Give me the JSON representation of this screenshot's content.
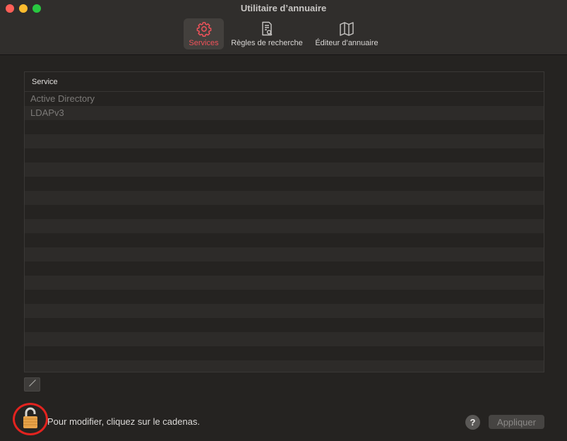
{
  "window": {
    "title": "Utilitaire d’annuaire"
  },
  "toolbar": {
    "tabs": [
      {
        "label": "Services",
        "icon": "gear-icon",
        "active": true
      },
      {
        "label": "Règles de recherche",
        "icon": "search-document-icon",
        "active": false
      },
      {
        "label": "Éditeur d’annuaire",
        "icon": "map-icon",
        "active": false
      }
    ]
  },
  "services_table": {
    "column_header": "Service",
    "rows": [
      "Active Directory",
      "LDAPv3"
    ]
  },
  "footer": {
    "lock_message": "Pour modifier, cliquez sur le cadenas.",
    "help_label": "?",
    "apply_label": "Appliquer"
  },
  "colors": {
    "accent": "#f0525a",
    "highlight_ring": "#e3231f"
  }
}
